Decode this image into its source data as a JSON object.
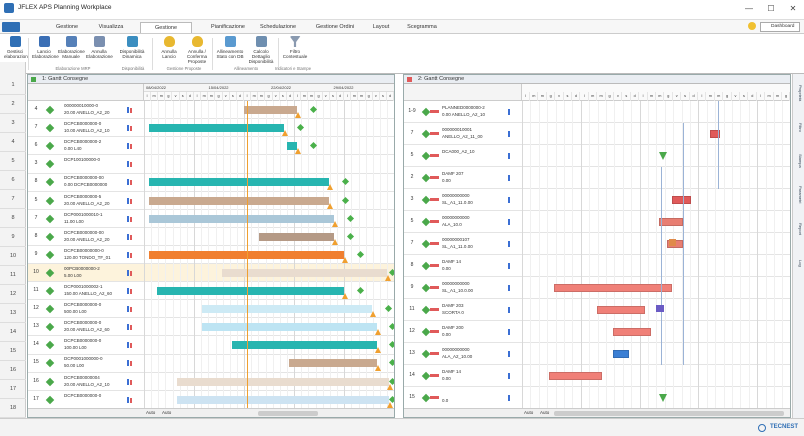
{
  "window": {
    "title": "JFLEX APS Planning Workplace",
    "controls": [
      "—",
      "☐",
      "✕"
    ]
  },
  "ribbon": {
    "tabs": [
      "Gestione",
      "Visualizza",
      "Gestione Fabbisogni",
      "Pianificazione",
      "Schedulazione",
      "Gestione Ordini",
      "Layout",
      "Scegramma"
    ],
    "active_tab": "Gestione Fabbisogni",
    "user_label": "Dashboard",
    "buttons": [
      {
        "label": "Lancio Elaborazione",
        "icon": "list-icon"
      },
      {
        "label": "Elaborazione Manuale",
        "icon": "grid-icon"
      },
      {
        "label": "Annulla Elaborazione",
        "icon": "cancel-grid-icon"
      },
      {
        "label": "Disponibilità Dinamica",
        "icon": "chart-icon"
      },
      {
        "label": "Annulla Lancio",
        "icon": "shield-icon"
      },
      {
        "label": "Annulla / Conferma Proposte",
        "icon": "check-shield-icon"
      },
      {
        "label": "Allineamento Stato con DB",
        "icon": "sync-icon"
      },
      {
        "label": "Calcolo Dettaglio Disponibilità",
        "icon": "calc-icon"
      },
      {
        "label": "Filtro Contestuale",
        "icon": "filter-icon"
      }
    ],
    "groups": [
      "Elaborazione MRP",
      "Disponibilità",
      "Gestione Proposte",
      "Allineamento",
      "Indicatori e Stampe"
    ],
    "left_label": "Gestisci elaborazioni"
  },
  "left_panel": {
    "title": "1: Gantt Consegne",
    "dates": [
      "08/04/2022",
      "15/04/2022",
      "22/04/2022",
      "29/04/2022"
    ],
    "rows": [
      {
        "num": "4",
        "code": "000000010000-0",
        "desc": "20.00   ANELLO_A2_20",
        "selected": false
      },
      {
        "num": "7",
        "code": "DCPCB0000000-0",
        "desc": "10.00   ANELLO_A2_10",
        "selected": false
      },
      {
        "num": "6",
        "code": "DCPCB0000000-2",
        "desc": "0.00   L40",
        "selected": false
      },
      {
        "num": "3",
        "code": "DCP100100000-0",
        "desc": "",
        "selected": false
      },
      {
        "num": "8",
        "code": "DCPCB0000000-00",
        "desc": "0.00   DCPCB0000000",
        "selected": false
      },
      {
        "num": "5",
        "code": "DCPCB0000000-5",
        "desc": "20.00   ANELLO_A2_20",
        "selected": false
      },
      {
        "num": "7",
        "code": "DCP0001000010-1",
        "desc": "11.00   L00",
        "selected": false
      },
      {
        "num": "8",
        "code": "DCPCB0000000-00",
        "desc": "20.00   ANELLO_A2_20",
        "selected": false
      },
      {
        "num": "9",
        "code": "DCPCB00000000-0",
        "desc": "120.00   TONDO_TF_01",
        "selected": false
      },
      {
        "num": "10",
        "code": "00PCB0000000-2",
        "desc": "5.00   L00",
        "selected": true
      },
      {
        "num": "11",
        "code": "DCP0001000002-1",
        "desc": "150.00   ANELLO_A2_60",
        "selected": false
      },
      {
        "num": "12",
        "code": "DCPCB0000000-0",
        "desc": "500.00   L00",
        "selected": false
      },
      {
        "num": "13",
        "code": "DCPCB0000000-0",
        "desc": "20.00   ANELLO_A2_60",
        "selected": false
      },
      {
        "num": "14",
        "code": "DCPCB0000000-0",
        "desc": "100.00   L00",
        "selected": false
      },
      {
        "num": "15",
        "code": "DCP0001000000-0",
        "desc": "50.00   L00",
        "selected": false
      },
      {
        "num": "16",
        "code": "DCPCB00000004",
        "desc": "20.00   ANELLO_A2_10",
        "selected": false
      },
      {
        "num": "17",
        "code": "DCPCB0000000-0",
        "desc": "",
        "selected": false
      }
    ],
    "bars": [
      {
        "row": 0,
        "start": 0.4,
        "end": 0.61,
        "color": "#c9a98f"
      },
      {
        "row": 1,
        "start": 0.02,
        "end": 0.56,
        "color": "#27b5b0"
      },
      {
        "row": 2,
        "start": 0.57,
        "end": 0.61,
        "color": "#27b5b0"
      },
      {
        "row": 4,
        "start": 0.02,
        "end": 0.74,
        "color": "#27b5b0"
      },
      {
        "row": 5,
        "start": 0.02,
        "end": 0.74,
        "color": "#c9a98f"
      },
      {
        "row": 6,
        "start": 0.02,
        "end": 0.76,
        "color": "#aac7d8"
      },
      {
        "row": 7,
        "start": 0.46,
        "end": 0.76,
        "color": "#b59a86"
      },
      {
        "row": 8,
        "start": 0.02,
        "end": 0.8,
        "color": "#f07f30"
      },
      {
        "row": 9,
        "start": 0.31,
        "end": 0.97,
        "color": "#e9dccf"
      },
      {
        "row": 10,
        "start": 0.05,
        "end": 0.8,
        "color": "#27b5b0"
      },
      {
        "row": 11,
        "start": 0.23,
        "end": 0.91,
        "color": "#cdeaf5"
      },
      {
        "row": 12,
        "start": 0.23,
        "end": 0.93,
        "color": "#bde4f3"
      },
      {
        "row": 13,
        "start": 0.35,
        "end": 0.93,
        "color": "#27b5b0"
      },
      {
        "row": 14,
        "start": 0.58,
        "end": 0.93,
        "color": "#c9a98f"
      },
      {
        "row": 15,
        "start": 0.13,
        "end": 0.98,
        "color": "#e9dccf"
      },
      {
        "row": 16,
        "start": 0.13,
        "end": 0.98,
        "color": "#cde3f2"
      }
    ],
    "footer": [
      "Auto",
      "Auto"
    ]
  },
  "right_panel": {
    "title": "2: Gantt Consegne",
    "rows": [
      {
        "num": "1-9",
        "code": "PLANNED0000000-2",
        "desc": "0.00   ANELLO_A2_10"
      },
      {
        "num": "7",
        "code": "000000010001",
        "desc": "ANELLO_A2_11_00"
      },
      {
        "num": "5",
        "code": "DCA000_A2_10",
        "desc": ""
      },
      {
        "num": "2",
        "code": "DAMF   207",
        "desc": "0.00"
      },
      {
        "num": "3",
        "code": "00000000000",
        "desc": "SL_A1_11.0.00"
      },
      {
        "num": "5",
        "code": "00000000000",
        "desc": "ALA_10.0"
      },
      {
        "num": "7",
        "code": "00000000107",
        "desc": "SL_A1_11.0.00"
      },
      {
        "num": "8",
        "code": "DAMF   14",
        "desc": "0.00"
      },
      {
        "num": "9",
        "code": "00000000000",
        "desc": "SL_A1_10.0.00"
      },
      {
        "num": "11",
        "code": "DAMF   203",
        "desc": "SCORTA 0"
      },
      {
        "num": "12",
        "code": "DAMF   200",
        "desc": "0.00"
      },
      {
        "num": "13",
        "code": "00000000000",
        "desc": "ALA_A2_10.00"
      },
      {
        "num": "14",
        "code": "DAMF   14",
        "desc": "0.00"
      },
      {
        "num": "15",
        "code": "",
        "desc": "0.0"
      }
    ],
    "bars": [
      {
        "row": 1,
        "start": 0.7,
        "end": 0.74,
        "color": "#e05a5a"
      },
      {
        "row": 4,
        "start": 0.56,
        "end": 0.63,
        "color": "#e05a5a"
      },
      {
        "row": 5,
        "start": 0.51,
        "end": 0.6,
        "color": "#e87e72"
      },
      {
        "row": 6,
        "start": 0.54,
        "end": 0.6,
        "color": "#e87e72"
      },
      {
        "row": 8,
        "start": 0.12,
        "end": 0.56,
        "color": "#f08078"
      },
      {
        "row": 9,
        "start": 0.28,
        "end": 0.46,
        "color": "#f08078"
      },
      {
        "row": 10,
        "start": 0.34,
        "end": 0.48,
        "color": "#f08078"
      },
      {
        "row": 11,
        "start": 0.34,
        "end": 0.4,
        "color": "#3b7fd4"
      },
      {
        "row": 12,
        "start": 0.1,
        "end": 0.3,
        "color": "#f08078"
      }
    ],
    "footer": [
      "Auto",
      "Auto"
    ]
  },
  "side_tabs": [
    "Proprietà",
    "Filtro",
    "Stampa",
    "Parametri",
    "Report",
    "Log"
  ],
  "status": {
    "brand": "TECNEST"
  },
  "colors": {
    "accent": "#2f6fb5",
    "teal": "#27b5b0",
    "red": "#e05a5a",
    "green": "#4aa84a",
    "orange": "#f0a030"
  }
}
